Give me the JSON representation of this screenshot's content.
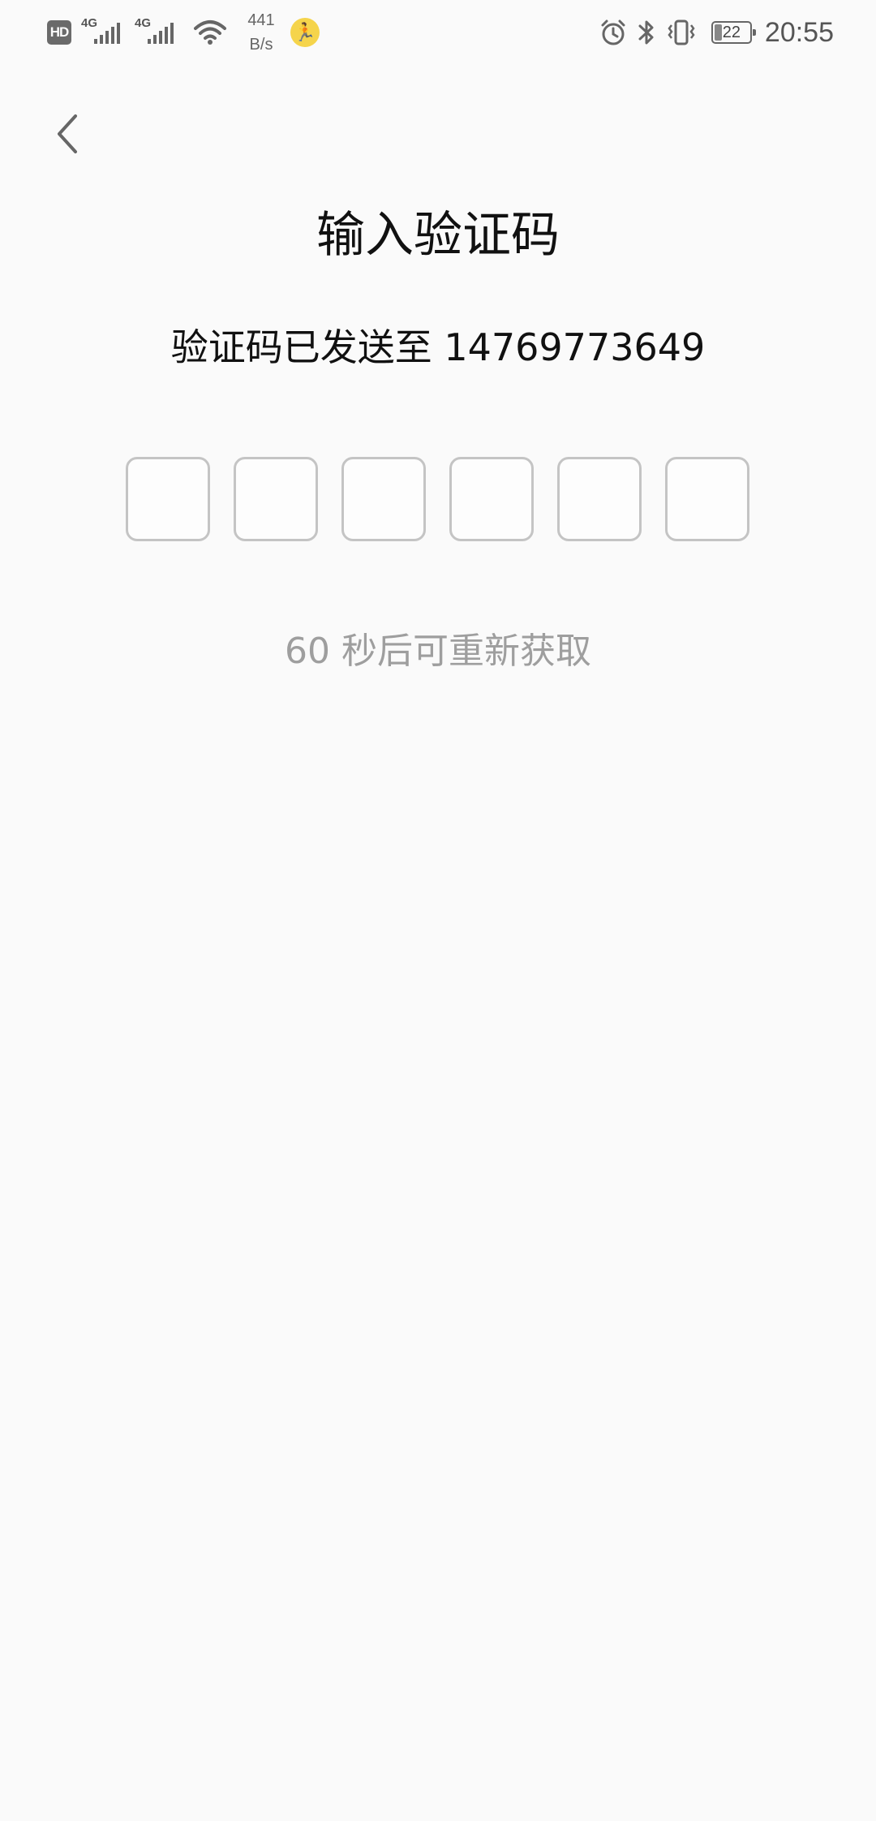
{
  "status_bar": {
    "hd_label": "HD",
    "network_1": "4G",
    "network_2": "4G",
    "speed_value": "441",
    "speed_unit": "B/s",
    "battery_level": "22",
    "time": "20:55",
    "icons": [
      "hd-icon",
      "signal-icon",
      "signal-icon",
      "wifi-icon",
      "running-app-icon",
      "alarm-icon",
      "bluetooth-icon",
      "vibrate-icon",
      "battery-icon"
    ],
    "runner_color": "#f5d44b"
  },
  "nav": {
    "back_icon": "chevron-left-icon"
  },
  "verify": {
    "title": "输入验证码",
    "sent_text": "验证码已发送至 14769773649",
    "code_digits": [
      "",
      "",
      "",
      "",
      "",
      ""
    ],
    "countdown_text": "60 秒后可重新获取"
  },
  "colors": {
    "background": "#fafafa",
    "box_border": "#c4c4c4",
    "hint_text": "#9e9e9e"
  }
}
